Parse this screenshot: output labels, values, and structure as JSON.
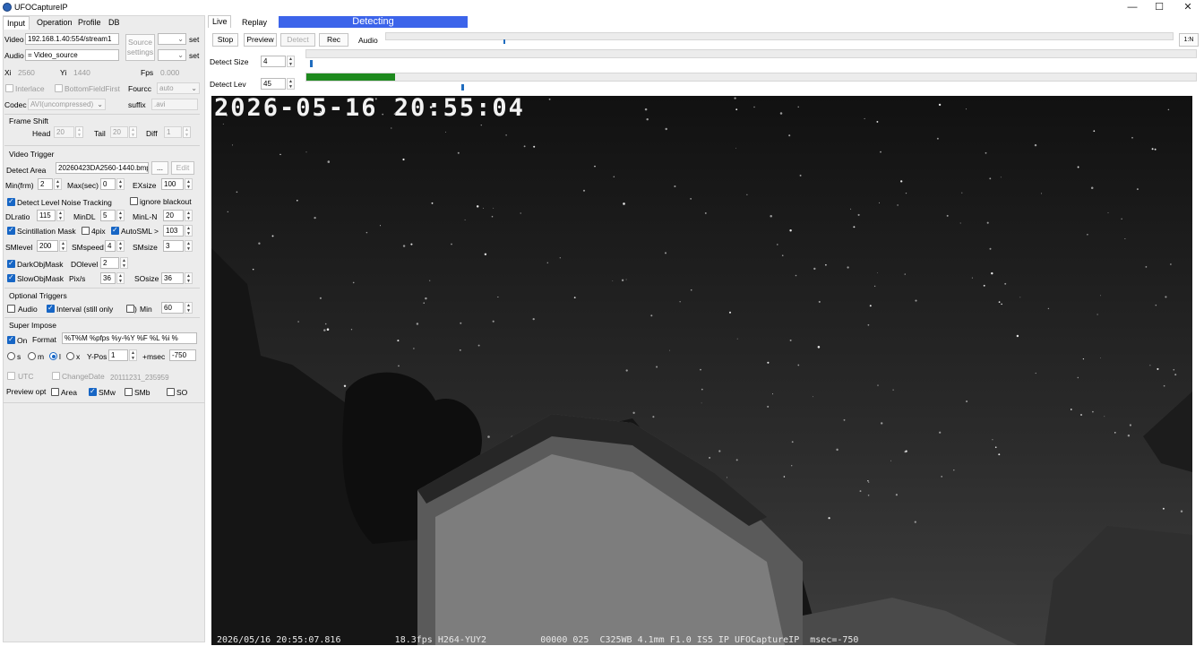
{
  "window": {
    "title": "UFOCaptureIP",
    "minimize": "—",
    "maximize": "☐",
    "close": "✕"
  },
  "left_tabs": [
    "Input",
    "Operation",
    "Profile",
    "DB"
  ],
  "input": {
    "video_label": "Video",
    "video_value": "192.168.1.40:554/stream1",
    "audio_label": "Audio",
    "audio_value": "= Video_source",
    "source_settings": "Source settings",
    "set1": "set",
    "set2": "set",
    "xi_label": "Xi",
    "xi_value": "2560",
    "yi_label": "Yi",
    "yi_value": "1440",
    "fps_label": "Fps",
    "fps_value": "0.000",
    "interlace": "Interlace",
    "bottom_field_first": "BottomFieldFirst",
    "fourcc_label": "Fourcc",
    "fourcc_value": "auto",
    "codec_label": "Codec",
    "codec_value": "AVI(uncompressed)",
    "suffix_label": "suffix",
    "suffix_value": ".avi"
  },
  "frame_shift": {
    "title": "Frame Shift",
    "head_label": "Head",
    "head_value": "20",
    "tail_label": "Tail",
    "tail_value": "20",
    "diff_label": "Diff",
    "diff_value": "1"
  },
  "video_trigger": {
    "title": "Video Trigger",
    "detect_area_label": "Detect Area",
    "detect_area_value": "20260423DA2560-1440.bmp",
    "browse": "...",
    "edit": "Edit",
    "minfrm_label": "Min(frm)",
    "minfrm_value": "2",
    "maxsec_label": "Max(sec)",
    "maxsec_value": "0",
    "exsize_label": "EXsize",
    "exsize_value": "100",
    "noise_tracking": "Detect Level Noise Tracking",
    "ignore_blackout": "ignore blackout",
    "dlratio_label": "DLratio",
    "dlratio_value": "115",
    "mindl_label": "MinDL",
    "mindl_value": "5",
    "minln_label": "MinL-N",
    "minln_value": "20",
    "scint_mask": "Scintillation Mask",
    "fourpix": "4pix",
    "autosml": "AutoSML >",
    "autosml_value": "103",
    "smlevel_label": "SMlevel",
    "smlevel_value": "200",
    "smspeed_label": "SMspeed",
    "smspeed_value": "4",
    "smsize_label": "SMsize",
    "smsize_value": "3",
    "darkobj": "DarkObjMask",
    "dolevel_label": "DOlevel",
    "dolevel_value": "2",
    "slowobj": "SlowObjMask",
    "pixs_label": "Pix/s",
    "pixs_value": "36",
    "sosize_label": "SOsize",
    "sosize_value": "36"
  },
  "optional_triggers": {
    "title": "Optional Triggers",
    "audio": "Audio",
    "interval": "Interval (still only",
    "min_paren": ")",
    "min_label": "Min",
    "min_value": "60"
  },
  "super_impose": {
    "title": "Super Impose",
    "on": "On",
    "format_label": "Format",
    "format_value": "%T%M          %pfps %y-%Y %F %L  %i %",
    "s": "s",
    "m": "m",
    "l": "l",
    "x": "x",
    "ypos_label": "Y-Pos",
    "ypos_value": "1",
    "msec_label": "+msec",
    "msec_value": "-750",
    "utc": "UTC",
    "change_date": "ChangeDate",
    "change_date_value": "20111231_235959"
  },
  "preview_opt": {
    "label": "Preview opt",
    "area": "Area",
    "smw": "SMw",
    "smb": "SMb",
    "so": "SO"
  },
  "top_tabs": [
    "Live",
    "Replay"
  ],
  "status": {
    "text": "Detecting",
    "color": "#3c64ea"
  },
  "controls": {
    "stop": "Stop",
    "preview": "Preview",
    "detect": "Detect",
    "rec": "Rec",
    "audio": "Audio",
    "tn": "1:N"
  },
  "detect_size": {
    "label": "Detect Size",
    "value": "4"
  },
  "detect_lev": {
    "label": "Detect Lev",
    "value": "45",
    "level_fraction": 0.1,
    "level_color": "#1e8a1e"
  },
  "video": {
    "timestamp": "2026-05-16  20:55:04",
    "footer": "2026/05/16 20:55:07.816          18.3fps H264-YUY2          00000 025  C325WB 4.1mm F1.0 IS5 IP UFOCaptureIP  msec=-750"
  }
}
